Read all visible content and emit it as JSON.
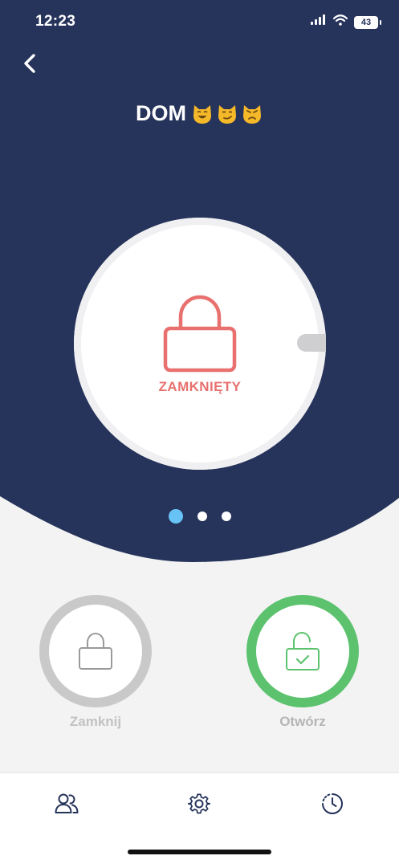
{
  "status_bar": {
    "time": "12:23",
    "battery": "43"
  },
  "header": {
    "title": "DOM",
    "emoji_icons": [
      "smiling-cat-icon",
      "smirking-cat-icon",
      "pouting-cat-icon"
    ]
  },
  "lock": {
    "state_label": "ZAMKNIĘTY",
    "state_color": "#e8716f"
  },
  "pager": {
    "page_count": 3,
    "active_index": 0
  },
  "actions": {
    "close": {
      "label": "Zamknij",
      "color": "#c9c9c9"
    },
    "open": {
      "label": "Otwórz",
      "color": "#5cc26e"
    }
  },
  "tab_bar": {
    "items": [
      {
        "icon": "users-icon"
      },
      {
        "icon": "gear-icon"
      },
      {
        "icon": "history-clock-icon"
      }
    ]
  },
  "colors": {
    "primary": "#26335a",
    "background": "#f3f3f3",
    "accent_blue": "#67c3f6"
  }
}
